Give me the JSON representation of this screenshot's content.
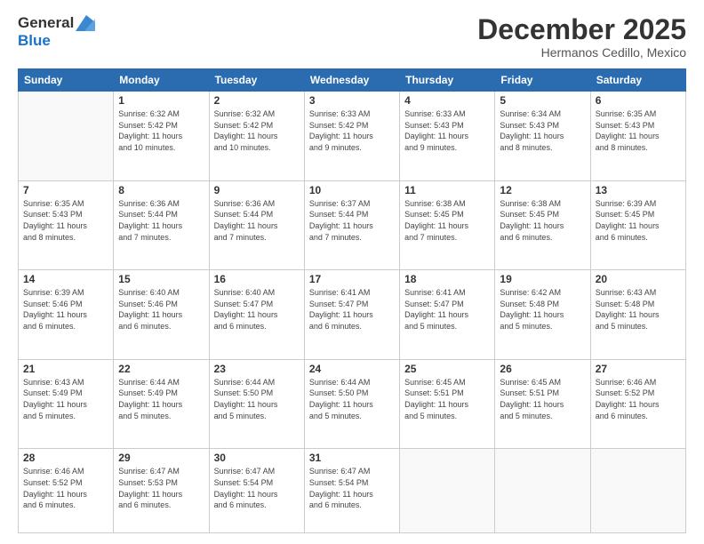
{
  "logo": {
    "line1": "General",
    "line2": "Blue"
  },
  "title": "December 2025",
  "subtitle": "Hermanos Cedillo, Mexico",
  "days_of_week": [
    "Sunday",
    "Monday",
    "Tuesday",
    "Wednesday",
    "Thursday",
    "Friday",
    "Saturday"
  ],
  "weeks": [
    [
      {
        "day": "",
        "info": ""
      },
      {
        "day": "1",
        "info": "Sunrise: 6:32 AM\nSunset: 5:42 PM\nDaylight: 11 hours\nand 10 minutes."
      },
      {
        "day": "2",
        "info": "Sunrise: 6:32 AM\nSunset: 5:42 PM\nDaylight: 11 hours\nand 10 minutes."
      },
      {
        "day": "3",
        "info": "Sunrise: 6:33 AM\nSunset: 5:42 PM\nDaylight: 11 hours\nand 9 minutes."
      },
      {
        "day": "4",
        "info": "Sunrise: 6:33 AM\nSunset: 5:43 PM\nDaylight: 11 hours\nand 9 minutes."
      },
      {
        "day": "5",
        "info": "Sunrise: 6:34 AM\nSunset: 5:43 PM\nDaylight: 11 hours\nand 8 minutes."
      },
      {
        "day": "6",
        "info": "Sunrise: 6:35 AM\nSunset: 5:43 PM\nDaylight: 11 hours\nand 8 minutes."
      }
    ],
    [
      {
        "day": "7",
        "info": "Sunrise: 6:35 AM\nSunset: 5:43 PM\nDaylight: 11 hours\nand 8 minutes."
      },
      {
        "day": "8",
        "info": "Sunrise: 6:36 AM\nSunset: 5:44 PM\nDaylight: 11 hours\nand 7 minutes."
      },
      {
        "day": "9",
        "info": "Sunrise: 6:36 AM\nSunset: 5:44 PM\nDaylight: 11 hours\nand 7 minutes."
      },
      {
        "day": "10",
        "info": "Sunrise: 6:37 AM\nSunset: 5:44 PM\nDaylight: 11 hours\nand 7 minutes."
      },
      {
        "day": "11",
        "info": "Sunrise: 6:38 AM\nSunset: 5:45 PM\nDaylight: 11 hours\nand 7 minutes."
      },
      {
        "day": "12",
        "info": "Sunrise: 6:38 AM\nSunset: 5:45 PM\nDaylight: 11 hours\nand 6 minutes."
      },
      {
        "day": "13",
        "info": "Sunrise: 6:39 AM\nSunset: 5:45 PM\nDaylight: 11 hours\nand 6 minutes."
      }
    ],
    [
      {
        "day": "14",
        "info": "Sunrise: 6:39 AM\nSunset: 5:46 PM\nDaylight: 11 hours\nand 6 minutes."
      },
      {
        "day": "15",
        "info": "Sunrise: 6:40 AM\nSunset: 5:46 PM\nDaylight: 11 hours\nand 6 minutes."
      },
      {
        "day": "16",
        "info": "Sunrise: 6:40 AM\nSunset: 5:47 PM\nDaylight: 11 hours\nand 6 minutes."
      },
      {
        "day": "17",
        "info": "Sunrise: 6:41 AM\nSunset: 5:47 PM\nDaylight: 11 hours\nand 6 minutes."
      },
      {
        "day": "18",
        "info": "Sunrise: 6:41 AM\nSunset: 5:47 PM\nDaylight: 11 hours\nand 5 minutes."
      },
      {
        "day": "19",
        "info": "Sunrise: 6:42 AM\nSunset: 5:48 PM\nDaylight: 11 hours\nand 5 minutes."
      },
      {
        "day": "20",
        "info": "Sunrise: 6:43 AM\nSunset: 5:48 PM\nDaylight: 11 hours\nand 5 minutes."
      }
    ],
    [
      {
        "day": "21",
        "info": "Sunrise: 6:43 AM\nSunset: 5:49 PM\nDaylight: 11 hours\nand 5 minutes."
      },
      {
        "day": "22",
        "info": "Sunrise: 6:44 AM\nSunset: 5:49 PM\nDaylight: 11 hours\nand 5 minutes."
      },
      {
        "day": "23",
        "info": "Sunrise: 6:44 AM\nSunset: 5:50 PM\nDaylight: 11 hours\nand 5 minutes."
      },
      {
        "day": "24",
        "info": "Sunrise: 6:44 AM\nSunset: 5:50 PM\nDaylight: 11 hours\nand 5 minutes."
      },
      {
        "day": "25",
        "info": "Sunrise: 6:45 AM\nSunset: 5:51 PM\nDaylight: 11 hours\nand 5 minutes."
      },
      {
        "day": "26",
        "info": "Sunrise: 6:45 AM\nSunset: 5:51 PM\nDaylight: 11 hours\nand 5 minutes."
      },
      {
        "day": "27",
        "info": "Sunrise: 6:46 AM\nSunset: 5:52 PM\nDaylight: 11 hours\nand 6 minutes."
      }
    ],
    [
      {
        "day": "28",
        "info": "Sunrise: 6:46 AM\nSunset: 5:52 PM\nDaylight: 11 hours\nand 6 minutes."
      },
      {
        "day": "29",
        "info": "Sunrise: 6:47 AM\nSunset: 5:53 PM\nDaylight: 11 hours\nand 6 minutes."
      },
      {
        "day": "30",
        "info": "Sunrise: 6:47 AM\nSunset: 5:54 PM\nDaylight: 11 hours\nand 6 minutes."
      },
      {
        "day": "31",
        "info": "Sunrise: 6:47 AM\nSunset: 5:54 PM\nDaylight: 11 hours\nand 6 minutes."
      },
      {
        "day": "",
        "info": ""
      },
      {
        "day": "",
        "info": ""
      },
      {
        "day": "",
        "info": ""
      }
    ]
  ]
}
